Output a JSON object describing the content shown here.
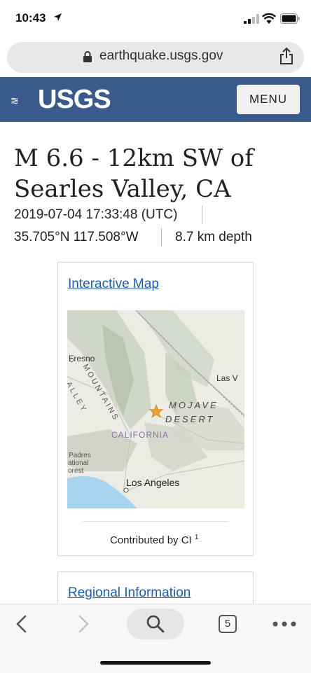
{
  "status_bar": {
    "time": "10:43"
  },
  "browser": {
    "url": "earthquake.usgs.gov",
    "tab_count": "5"
  },
  "header": {
    "logo_text": "USGS",
    "menu_label": "MENU"
  },
  "event": {
    "title": "M 6.6 - 12km SW of Searles Valley, CA",
    "time_utc": "2019-07-04 17:33:48 (UTC)",
    "coordinates": "35.705°N 117.508°W",
    "depth": "8.7 km depth"
  },
  "map_card": {
    "link_label": "Interactive Map",
    "credit_text": "Contributed by CI",
    "credit_ref": "1",
    "labels": {
      "fresno": "Fresno",
      "las_vegas": "Las V",
      "mojave": "MOJAVE",
      "desert": "DESERT",
      "california": "CALIFORNIA",
      "mountains": "MOUNTAINS",
      "valley": "ALLEY",
      "padres_1": "Padres",
      "padres_2": "ational",
      "padres_3": "orest",
      "los_angeles": "Los Angeles"
    }
  },
  "regional_card": {
    "link_label": "Regional Information"
  },
  "colors": {
    "header": "#3a5a8c",
    "link": "#1d5ea8",
    "epicenter_star": "#f0a030"
  }
}
